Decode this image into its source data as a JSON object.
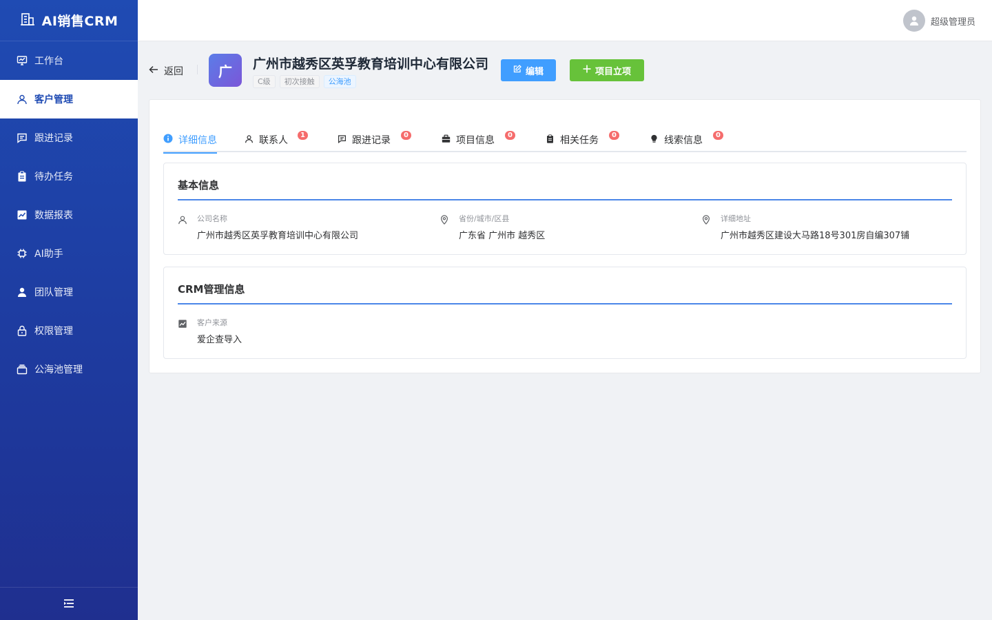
{
  "app": {
    "title": "AI销售CRM"
  },
  "sidebar": {
    "items": [
      {
        "label": "工作台",
        "icon": "dashboard-icon"
      },
      {
        "label": "客户管理",
        "icon": "user-icon"
      },
      {
        "label": "跟进记录",
        "icon": "message-icon"
      },
      {
        "label": "待办任务",
        "icon": "clipboard-icon"
      },
      {
        "label": "数据报表",
        "icon": "chart-icon"
      },
      {
        "label": "AI助手",
        "icon": "chip-icon"
      },
      {
        "label": "团队管理",
        "icon": "team-icon"
      },
      {
        "label": "权限管理",
        "icon": "lock-icon"
      },
      {
        "label": "公海池管理",
        "icon": "box-icon"
      }
    ],
    "active_index": 1
  },
  "header": {
    "user_name": "超级管理员"
  },
  "page": {
    "back_label": "返回",
    "avatar_char": "广",
    "customer_name": "广州市越秀区英孚教育培训中心有限公司",
    "tags": [
      "C级",
      "初次接触",
      "公海池"
    ],
    "edit_label": "编辑",
    "project_label": "项目立项"
  },
  "tabs": [
    {
      "label": "详细信息",
      "badge": null
    },
    {
      "label": "联系人",
      "badge": "1"
    },
    {
      "label": "跟进记录",
      "badge": "0"
    },
    {
      "label": "项目信息",
      "badge": "0"
    },
    {
      "label": "相关任务",
      "badge": "0"
    },
    {
      "label": "线索信息",
      "badge": "0"
    }
  ],
  "basic_info": {
    "title": "基本信息",
    "company_label": "公司名称",
    "company_value": "广州市越秀区英孚教育培训中心有限公司",
    "region_label": "省份/城市/区县",
    "region_value": "广东省 广州市 越秀区",
    "address_label": "详细地址",
    "address_value": "广州市越秀区建设大马路18号301房自编307铺"
  },
  "crm_info": {
    "title": "CRM管理信息",
    "source_label": "客户来源",
    "source_value": "爱企查导入"
  },
  "colors": {
    "sidebar": "#1f4bb3",
    "primary": "#409eff",
    "success": "#67c23a",
    "danger": "#f56c6c"
  }
}
